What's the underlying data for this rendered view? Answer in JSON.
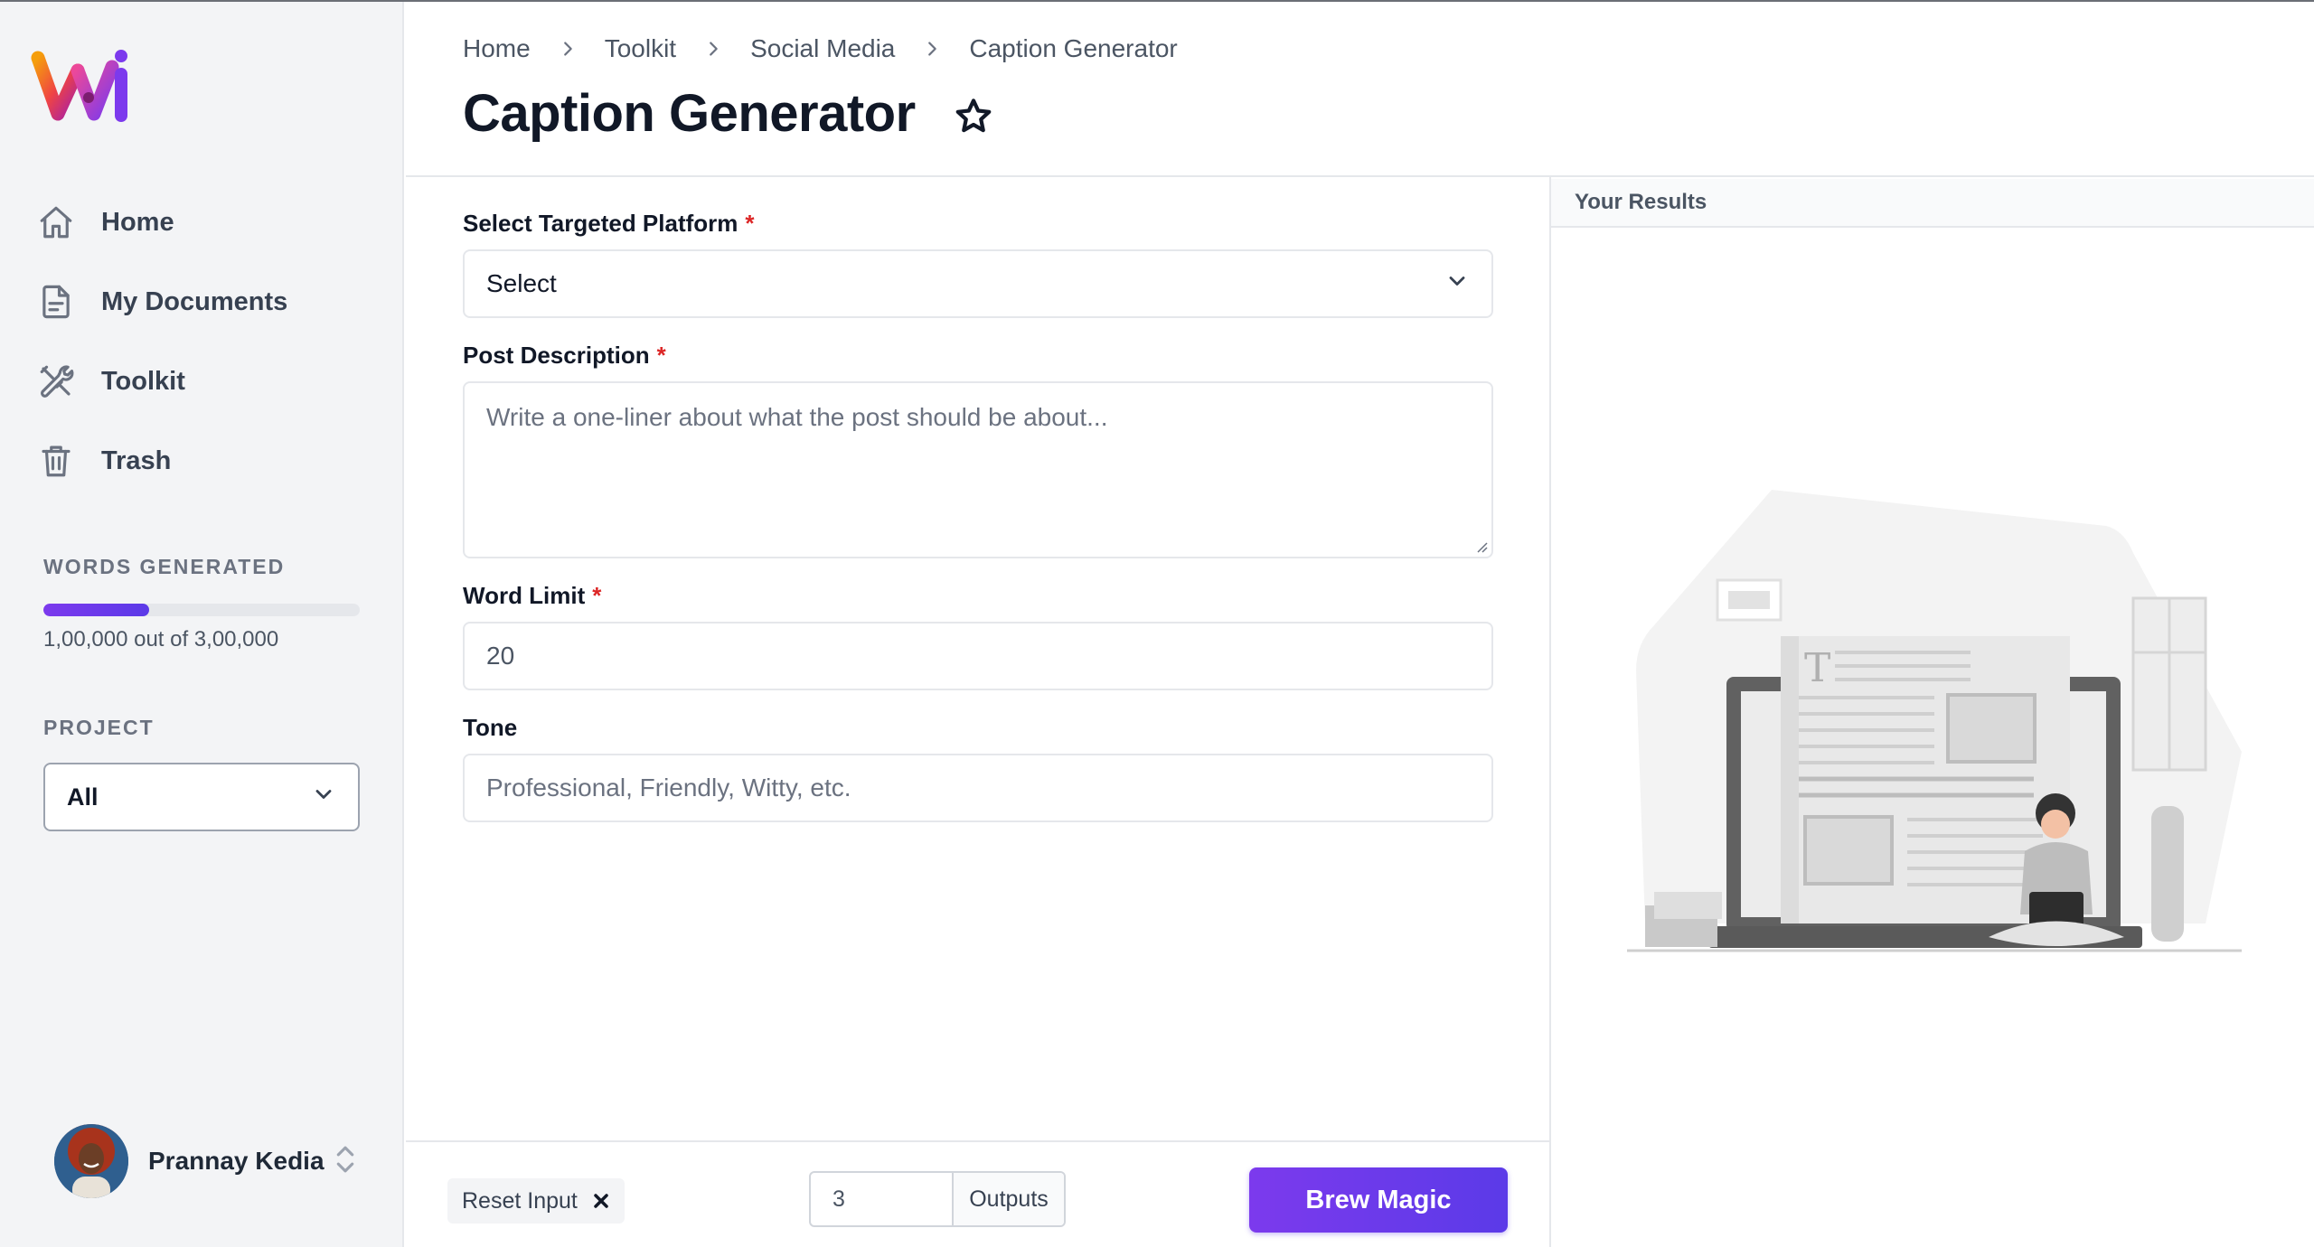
{
  "colors": {
    "accent": "#6d3ae8",
    "required": "#dc2626",
    "sidebar_bg": "#f3f4f6"
  },
  "sidebar": {
    "nav": [
      {
        "label": "Home",
        "icon": "home-icon"
      },
      {
        "label": "My Documents",
        "icon": "document-icon"
      },
      {
        "label": "Toolkit",
        "icon": "tools-icon"
      },
      {
        "label": "Trash",
        "icon": "trash-icon"
      }
    ],
    "words_generated": {
      "label": "WORDS GENERATED",
      "text": "1,00,000 out of 3,00,000",
      "fraction": 0.333
    },
    "project": {
      "label": "PROJECT",
      "selected": "All"
    },
    "user": {
      "name": "Prannay Kedia"
    }
  },
  "header": {
    "breadcrumb": [
      "Home",
      "Toolkit",
      "Social Media",
      "Caption Generator"
    ],
    "title": "Caption Generator"
  },
  "form": {
    "platform": {
      "label": "Select Targeted Platform",
      "required_mark": "*",
      "selected": "Select"
    },
    "description": {
      "label": "Post Description",
      "required_mark": "*",
      "placeholder": "Write a one-liner about what the post should be about..."
    },
    "word_limit": {
      "label": "Word Limit",
      "required_mark": "*",
      "value": "20"
    },
    "tone": {
      "label": "Tone",
      "placeholder": "Professional, Friendly, Witty, etc."
    }
  },
  "results": {
    "title": "Your Results"
  },
  "footer": {
    "reset_label": "Reset Input",
    "outputs_value": "3",
    "outputs_label": "Outputs",
    "submit_label": "Brew Magic"
  }
}
